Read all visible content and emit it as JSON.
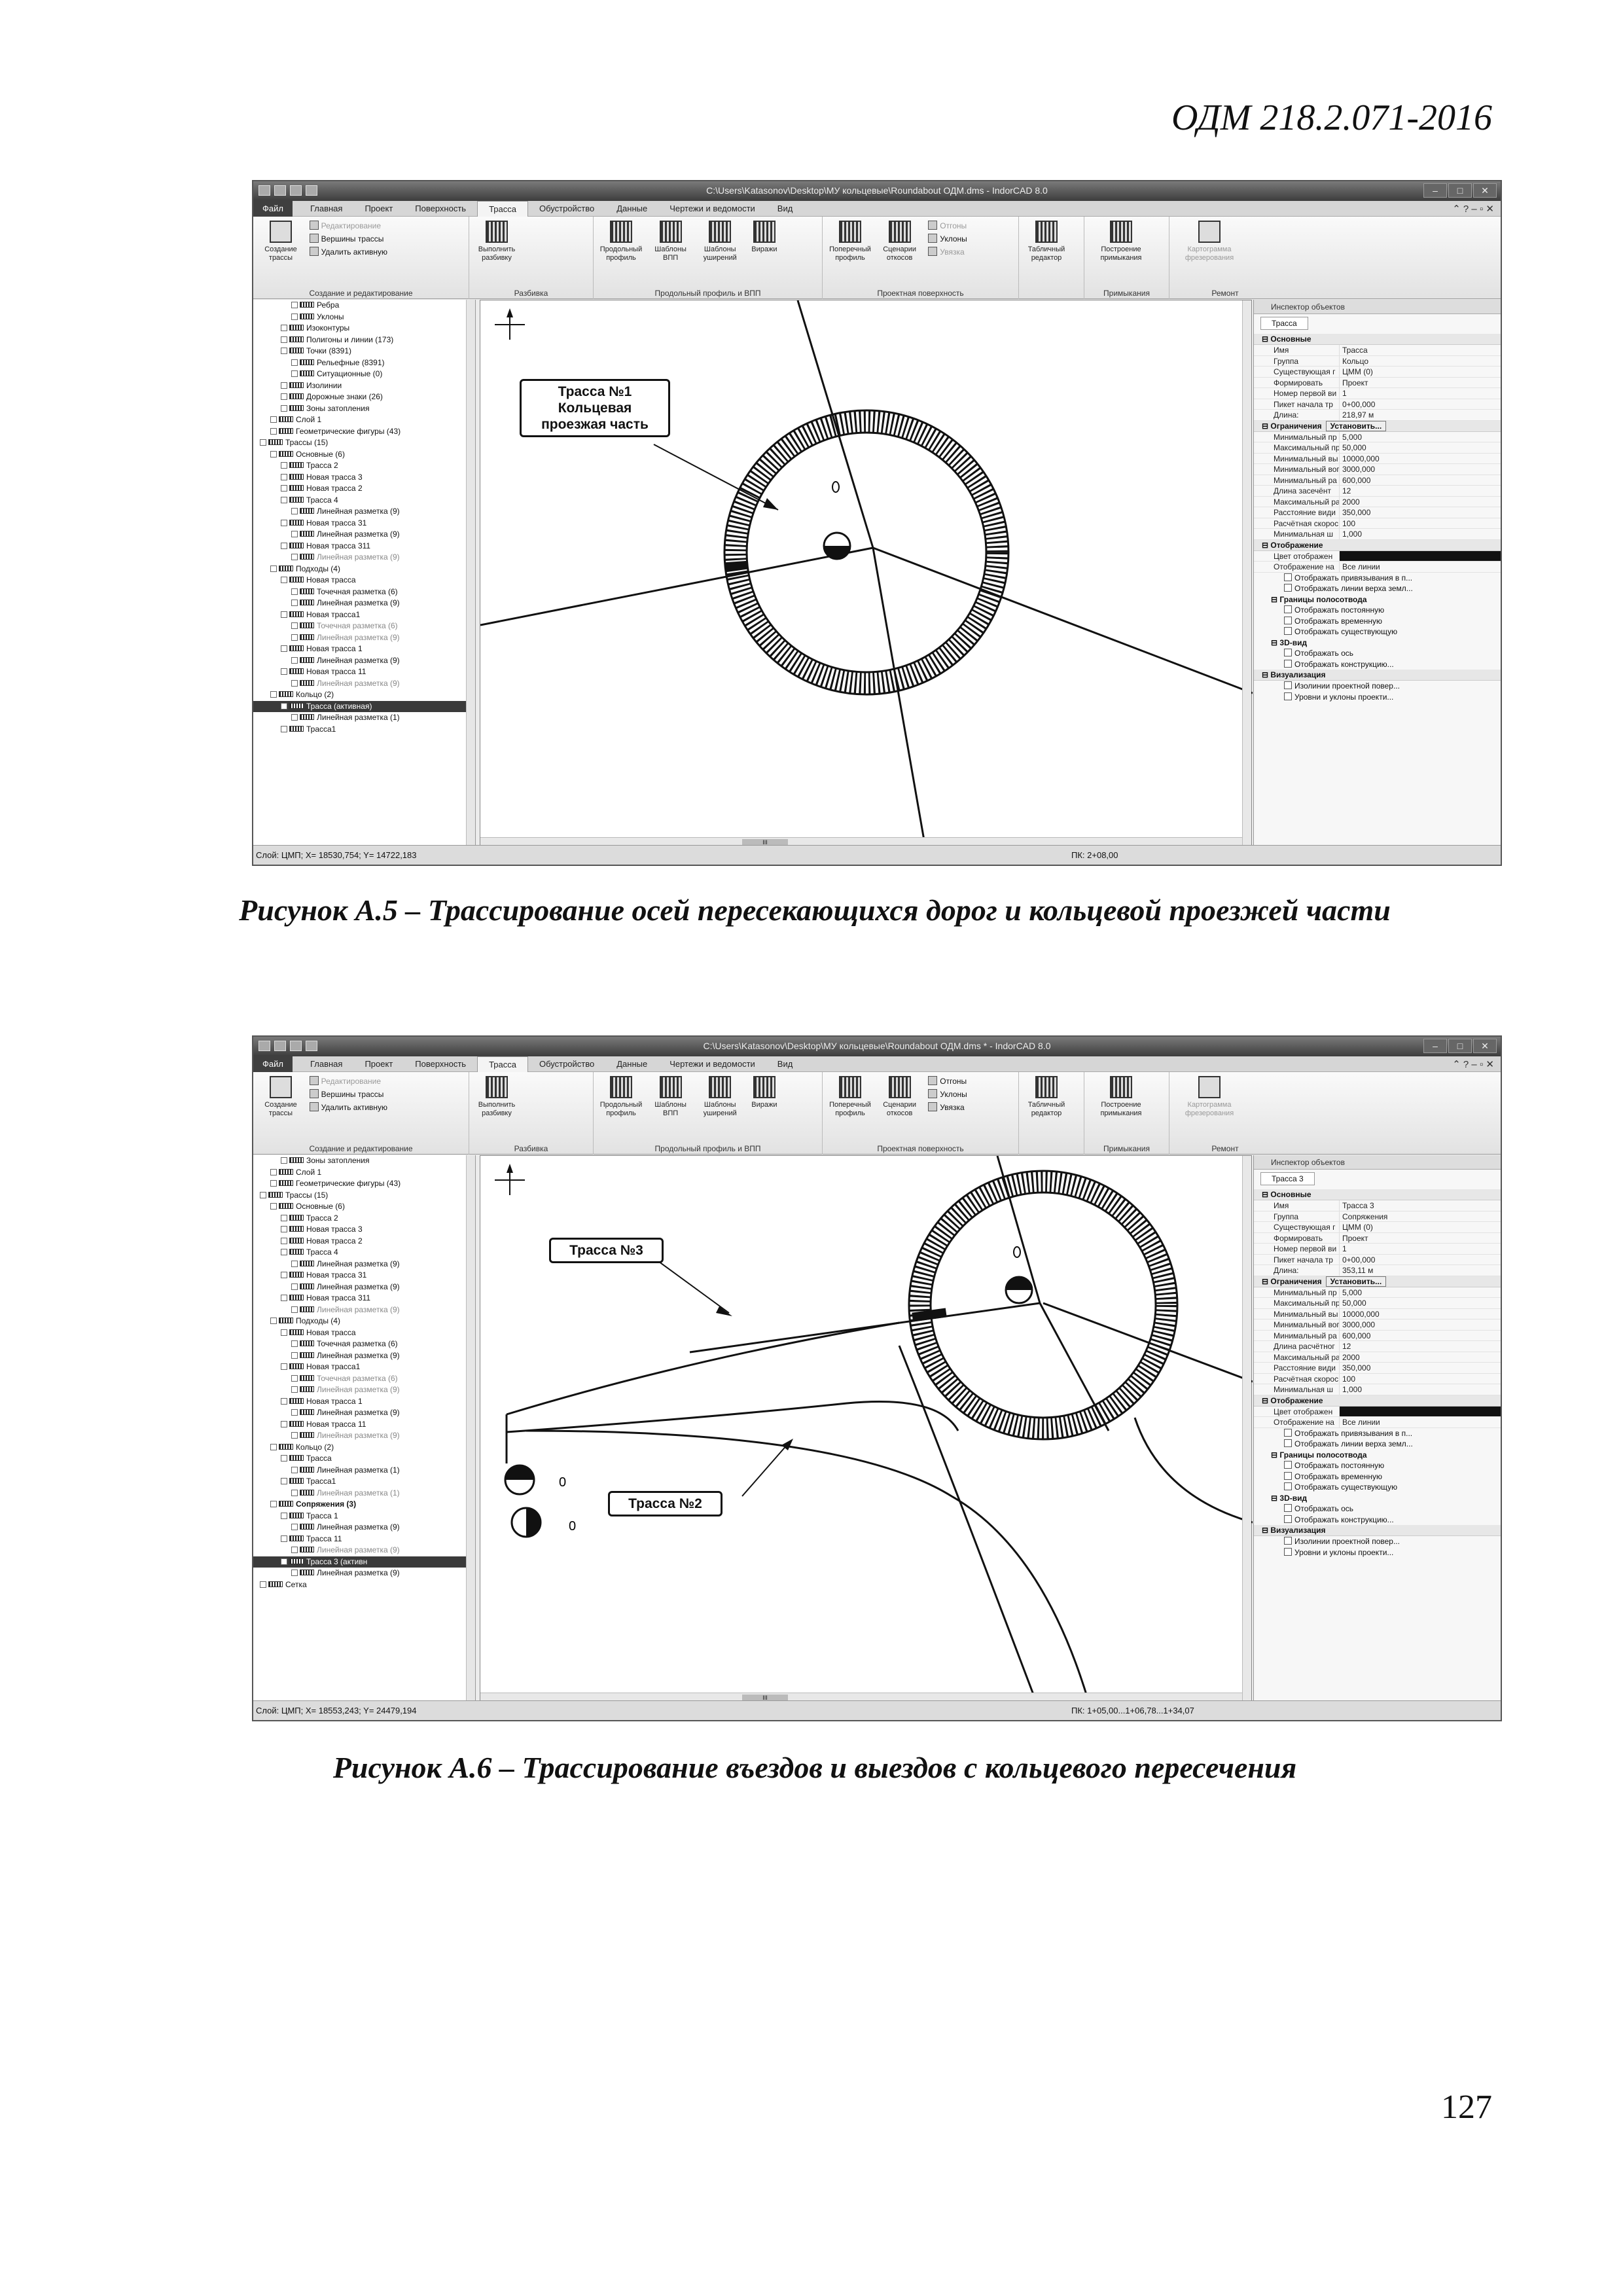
{
  "header": {
    "doc_code": "ОДМ 218.2.071-2016"
  },
  "page_number": "127",
  "app": {
    "window_title_1": "C:\\Users\\Katasonov\\Desktop\\МУ кольцевые\\Roundabout ОДМ.dms - IndorCAD 8.0",
    "window_title_2": "C:\\Users\\Katasonov\\Desktop\\МУ кольцевые\\Roundabout ОДМ.dms * - IndorCAD 8.0",
    "tabs": [
      "Файл",
      "Главная",
      "Проект",
      "Поверхность",
      "Трасса",
      "Обустройство",
      "Данные",
      "Чертежи и ведомости",
      "Вид"
    ],
    "ribbon": {
      "create_trass": "Создание трассы",
      "edit": "Редактирование",
      "vertices": "Вершины трассы",
      "delete_active": "Удалить активную",
      "group_create": "Создание и редактирование",
      "do_breakdown": "Выполнить разбивку",
      "group_breakdown": "Разбивка",
      "long_profile": "Продольный профиль",
      "templates_vpp": "Шаблоны ВПП",
      "templates_widen": "Шаблоны уширений",
      "virazhi": "Виражи",
      "group_profile": "Продольный профиль и ВПП",
      "cross_profile": "Поперечный профиль",
      "slope_scenarios": "Сценарии откосов",
      "otgony": "Отгоны",
      "uklony": "Уклоны",
      "uvyazka": "Увязка",
      "group_surface": "Проектная поверхность",
      "table_editor": "Табличный редактор",
      "build_junctions": "Построение примыкания",
      "group_junctions": "Примыкания",
      "milling_map": "Картограмма фрезерования",
      "group_repair": "Ремонт"
    },
    "inspector_title": "Инспектор объектов"
  },
  "figure1": {
    "caption": "Рисунок А.5 – Трассирование осей пересекающихся дорог и кольцевой проезжей части",
    "callout_lines": [
      "Трасса №1",
      "Кольцевая",
      "проезжая часть"
    ],
    "status_left": "Слой: ЦМП; X= 18530,754; Y= 14722,183",
    "status_pk": "ПК: 2+08,00",
    "tree": [
      {
        "t": "Ребра",
        "i": 3
      },
      {
        "t": "Уклоны",
        "i": 3
      },
      {
        "t": "Изоконтуры",
        "i": 2
      },
      {
        "t": "Полигоны и линии (173)",
        "i": 2
      },
      {
        "t": "Точки (8391)",
        "i": 2
      },
      {
        "t": "Рельефные (8391)",
        "i": 3
      },
      {
        "t": "Ситуационные (0)",
        "i": 3
      },
      {
        "t": "Изолинии",
        "i": 2
      },
      {
        "t": "Дорожные знаки (26)",
        "i": 2
      },
      {
        "t": "Зоны затопления",
        "i": 2
      },
      {
        "t": "Слой 1",
        "i": 1
      },
      {
        "t": "Геометрические фигуры (43)",
        "i": 1
      },
      {
        "t": "Трассы (15)",
        "i": 0
      },
      {
        "t": "Основные (6)",
        "i": 1
      },
      {
        "t": "Трасса 2",
        "i": 2
      },
      {
        "t": "Новая трасса 3",
        "i": 2
      },
      {
        "t": "Новая трасса 2",
        "i": 2
      },
      {
        "t": "Трасса 4",
        "i": 2
      },
      {
        "t": "Линейная разметка (9)",
        "i": 3
      },
      {
        "t": "Новая трасса 31",
        "i": 2
      },
      {
        "t": "Линейная разметка (9)",
        "i": 3
      },
      {
        "t": "Новая трасса 311",
        "i": 2
      },
      {
        "t": "Линейная разметка (9)",
        "i": 3,
        "muted": true
      },
      {
        "t": "Подходы (4)",
        "i": 1
      },
      {
        "t": "Новая трасса",
        "i": 2
      },
      {
        "t": "Точечная разметка (6)",
        "i": 3
      },
      {
        "t": "Линейная разметка (9)",
        "i": 3
      },
      {
        "t": "Новая трасса1",
        "i": 2
      },
      {
        "t": "Точечная разметка (6)",
        "i": 3,
        "muted": true
      },
      {
        "t": "Линейная разметка (9)",
        "i": 3,
        "muted": true
      },
      {
        "t": "Новая трасса 1",
        "i": 2
      },
      {
        "t": "Линейная разметка (9)",
        "i": 3
      },
      {
        "t": "Новая трасса 11",
        "i": 2
      },
      {
        "t": "Линейная разметка (9)",
        "i": 3,
        "muted": true
      },
      {
        "t": "Кольцо (2)",
        "i": 1
      },
      {
        "t": "Трасса (активная)",
        "i": 2,
        "sel": true
      },
      {
        "t": "Линейная разметка (1)",
        "i": 3
      },
      {
        "t": "Трасса1",
        "i": 2
      }
    ],
    "inspector_tab": "Трасса",
    "props": [
      {
        "sec": "Основные"
      },
      {
        "k": "Имя",
        "v": "Трасса"
      },
      {
        "k": "Группа",
        "v": "Кольцо"
      },
      {
        "k": "Существующая г",
        "v": "ЦММ (0)"
      },
      {
        "k": "Формировать",
        "v": "Проект"
      },
      {
        "k": "Номер первой ви",
        "v": "1"
      },
      {
        "k": "Пикет начала тр",
        "v": "0+00,000"
      },
      {
        "k": "Длина:",
        "v": "218,97 м"
      },
      {
        "sec": "Ограничения",
        "btn": "Установить..."
      },
      {
        "k": "Минимальный пр",
        "v": "5,000"
      },
      {
        "k": "Максимальный пр",
        "v": "50,000"
      },
      {
        "k": "Минимальный вы",
        "v": "10000,000"
      },
      {
        "k": "Минимальный вог",
        "v": "3000,000"
      },
      {
        "k": "Минимальный ра",
        "v": "600,000"
      },
      {
        "k": "Длина засечёнт",
        "v": "12"
      },
      {
        "k": "Максимальный ра",
        "v": "2000"
      },
      {
        "k": "Расстояние види",
        "v": "350,000"
      },
      {
        "k": "Расчётная скорос",
        "v": "100"
      },
      {
        "k": "Минимальная ш",
        "v": "1,000"
      },
      {
        "sec": "Отображение"
      },
      {
        "k": "Цвет отображен",
        "v": ""
      },
      {
        "k": "Отображение на",
        "v": "Все линии"
      },
      {
        "chk": "Отображать привязывания в п..."
      },
      {
        "chk": "Отображать линии верха земл..."
      },
      {
        "sub": "Границы полосотвода"
      },
      {
        "chk": "Отображать постоянную"
      },
      {
        "chk": "Отображать временную"
      },
      {
        "chk": "Отображать существующую"
      },
      {
        "sub": "3D-вид"
      },
      {
        "chk": "Отображать ось"
      },
      {
        "chk": "Отображать конструкцию..."
      },
      {
        "sec": "Визуализация"
      },
      {
        "chk": "Изолинии проектной повер..."
      },
      {
        "chk": "Уровни и уклоны проекти..."
      }
    ]
  },
  "figure2": {
    "caption": "Рисунок А.6 – Трассирование въездов и выездов с кольцевого пересечения",
    "callout_a": "Трасса №3",
    "callout_b": "Трасса №2",
    "zero_a": "0",
    "zero_b": "0",
    "status_left": "Слой: ЦМП; X= 18553,243; Y= 24479,194",
    "status_pk": "ПК: 1+05,00...1+06,78...1+34,07",
    "tree": [
      {
        "t": "Зоны затопления",
        "i": 2
      },
      {
        "t": "Слой 1",
        "i": 1
      },
      {
        "t": "Геометрические фигуры (43)",
        "i": 1
      },
      {
        "t": "Трассы (15)",
        "i": 0
      },
      {
        "t": "Основные (6)",
        "i": 1
      },
      {
        "t": "Трасса 2",
        "i": 2
      },
      {
        "t": "Новая трасса 3",
        "i": 2
      },
      {
        "t": "Новая трасса 2",
        "i": 2
      },
      {
        "t": "Трасса 4",
        "i": 2
      },
      {
        "t": "Линейная разметка (9)",
        "i": 3
      },
      {
        "t": "Новая трасса 31",
        "i": 2
      },
      {
        "t": "Линейная разметка (9)",
        "i": 3
      },
      {
        "t": "Новая трасса 311",
        "i": 2
      },
      {
        "t": "Линейная разметка (9)",
        "i": 3,
        "muted": true
      },
      {
        "t": "Подходы (4)",
        "i": 1
      },
      {
        "t": "Новая трасса",
        "i": 2
      },
      {
        "t": "Точечная разметка (6)",
        "i": 3
      },
      {
        "t": "Линейная разметка (9)",
        "i": 3
      },
      {
        "t": "Новая трасса1",
        "i": 2
      },
      {
        "t": "Точечная разметка (6)",
        "i": 3,
        "muted": true
      },
      {
        "t": "Линейная разметка (9)",
        "i": 3,
        "muted": true
      },
      {
        "t": "Новая трасса 1",
        "i": 2
      },
      {
        "t": "Линейная разметка (9)",
        "i": 3
      },
      {
        "t": "Новая трасса 11",
        "i": 2
      },
      {
        "t": "Линейная разметка (9)",
        "i": 3,
        "muted": true
      },
      {
        "t": "Кольцо (2)",
        "i": 1
      },
      {
        "t": "Трасса",
        "i": 2
      },
      {
        "t": "Линейная разметка (1)",
        "i": 3
      },
      {
        "t": "Трасса1",
        "i": 2
      },
      {
        "t": "Линейная разметка (1)",
        "i": 3,
        "muted": true
      },
      {
        "t": "Сопряжения (3)",
        "i": 1,
        "bold": true
      },
      {
        "t": "Трасса 1",
        "i": 2
      },
      {
        "t": "Линейная разметка (9)",
        "i": 3
      },
      {
        "t": "Трасса 11",
        "i": 2
      },
      {
        "t": "Линейная разметка (9)",
        "i": 3,
        "muted": true
      },
      {
        "t": "Трасса 3 (активн",
        "i": 2,
        "sel": true
      },
      {
        "t": "Линейная разметка (9)",
        "i": 3
      },
      {
        "t": "Сетка",
        "i": 0
      }
    ],
    "inspector_tab": "Трасса 3",
    "props": [
      {
        "sec": "Основные"
      },
      {
        "k": "Имя",
        "v": "Трасса 3"
      },
      {
        "k": "Группа",
        "v": "Сопряжения"
      },
      {
        "k": "Существующая г",
        "v": "ЦММ (0)"
      },
      {
        "k": "Формировать",
        "v": "Проект"
      },
      {
        "k": "Номер первой ви",
        "v": "1"
      },
      {
        "k": "Пикет начала тр",
        "v": "0+00,000"
      },
      {
        "k": "Длина:",
        "v": "353,11 м"
      },
      {
        "sec": "Ограничения",
        "btn": "Установить..."
      },
      {
        "k": "Минимальный пр",
        "v": "5,000"
      },
      {
        "k": "Максимальный пр",
        "v": "50,000"
      },
      {
        "k": "Минимальный вы",
        "v": "10000,000"
      },
      {
        "k": "Минимальный вог",
        "v": "3000,000"
      },
      {
        "k": "Минимальный ра",
        "v": "600,000"
      },
      {
        "k": "Длина расчётног",
        "v": "12"
      },
      {
        "k": "Максимальный ра",
        "v": "2000"
      },
      {
        "k": "Расстояние види",
        "v": "350,000"
      },
      {
        "k": "Расчётная скорос",
        "v": "100"
      },
      {
        "k": "Минимальная ш",
        "v": "1,000"
      },
      {
        "sec": "Отображение"
      },
      {
        "k": "Цвет отображен",
        "v": ""
      },
      {
        "k": "Отображение на",
        "v": "Все линии"
      },
      {
        "chk": "Отображать привязывания в п..."
      },
      {
        "chk": "Отображать линии верха земл..."
      },
      {
        "sub": "Границы полосотвода"
      },
      {
        "chk": "Отображать постоянную"
      },
      {
        "chk": "Отображать временную"
      },
      {
        "chk": "Отображать существующую"
      },
      {
        "sub": "3D-вид"
      },
      {
        "chk": "Отображать ось"
      },
      {
        "chk": "Отображать конструкцию..."
      },
      {
        "sec": "Визуализация"
      },
      {
        "chk": "Изолинии проектной повер..."
      },
      {
        "chk": "Уровни и уклоны проекти..."
      }
    ]
  }
}
